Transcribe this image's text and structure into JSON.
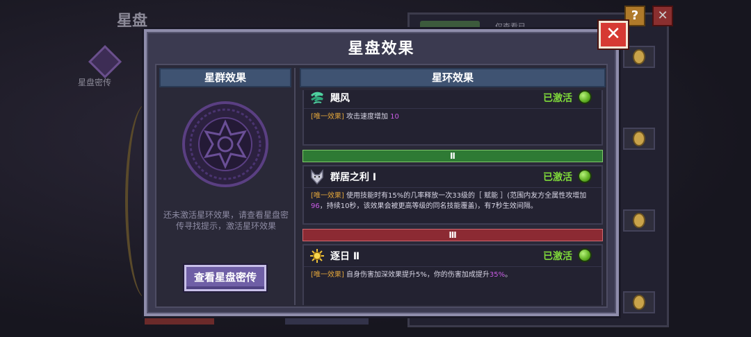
{
  "background": {
    "title": "星盘",
    "emblem_label": "星盘密传",
    "tab_text": "仅查看已",
    "help_icon": "?",
    "close_icon": "✕"
  },
  "modal": {
    "title": "星盘效果",
    "close_label": "✕",
    "left": {
      "header": "星群效果",
      "hint": "还未激活星环效果，请查看星盘密传寻找提示，激活星环效果",
      "button_label": "查看星盘密传"
    },
    "right": {
      "header": "星环效果",
      "effects": [
        {
          "name": "飓风",
          "status": "已激活",
          "icon": "whirlwind-icon",
          "tag": "[唯一效果]",
          "text_before": " 攻击速度增加 ",
          "num": "10",
          "text_after": ""
        },
        {
          "name": "群居之利 Ⅰ",
          "status": "已激活",
          "icon": "wolf-head-icon",
          "tag": "[唯一效果]",
          "text_before": " 使用技能时有15%的几率释放一次33级的［ 赋能 ］(范围内友方全属性攻增加",
          "num": "96",
          "text_after": "，持续10秒，该效果会被更高等级的同名技能覆盖)，有7秒生效间隔。"
        },
        {
          "name": "逐日 Ⅱ",
          "status": "已激活",
          "icon": "sun-icon",
          "tag": "[唯一效果]",
          "text_before": " 自身伤害加深效果提升5%，你的伤害加成提升",
          "num": "35%",
          "text_after": "。"
        }
      ],
      "tiers": [
        "Ⅱ",
        "Ⅲ"
      ]
    }
  },
  "colors": {
    "active_green": "#7fd93a",
    "tag_orange": "#e0a43a",
    "number_purple": "#c95ce6",
    "tier2_green": "#2e7a34",
    "tier3_red": "#8c2a33",
    "close_red": "#d63a33",
    "button_purple": "#6f5fa6"
  }
}
